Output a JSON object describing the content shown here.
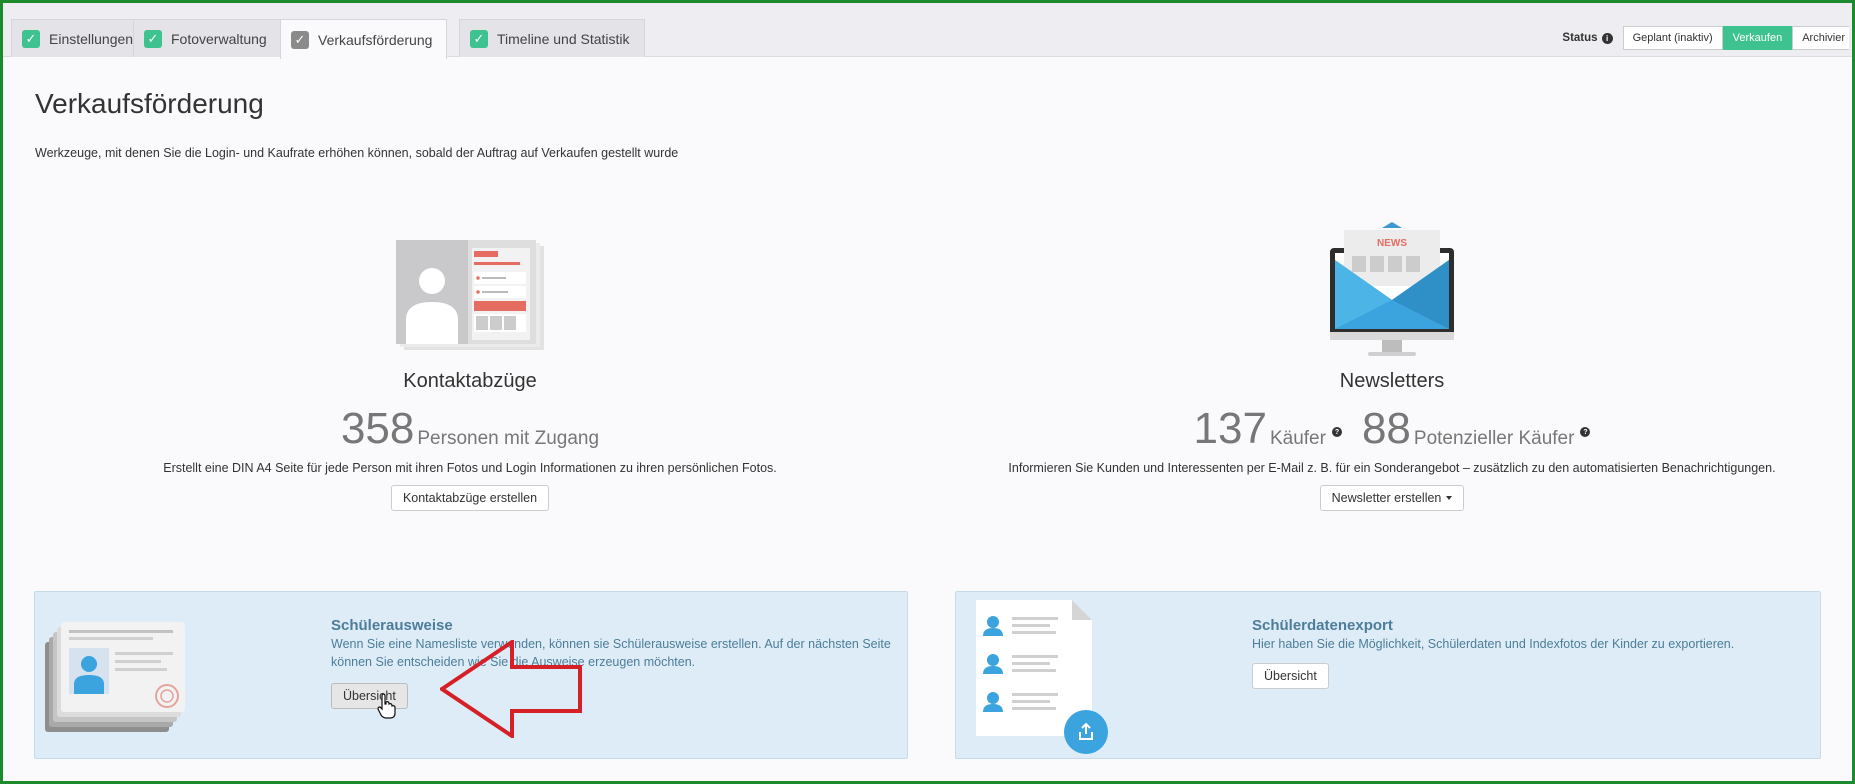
{
  "tabs": [
    {
      "label": "Einstellungen",
      "active": false
    },
    {
      "label": "Fotoverwaltung",
      "active": false
    },
    {
      "label": "Verkaufsförderung",
      "active": true
    },
    {
      "label": "Timeline und Statistik",
      "active": false
    }
  ],
  "status": {
    "label": "Status",
    "options": [
      "Geplant (inaktiv)",
      "Verkaufen",
      "Archivier"
    ],
    "selected": "Verkaufen"
  },
  "header": {
    "title": "Verkaufsförderung",
    "subtitle": "Werkzeuge, mit denen Sie die Login- und Kaufrate erhöhen können, sobald der Auftrag auf Verkaufen gestellt wurde"
  },
  "kontakt": {
    "title": "Kontaktabzüge",
    "count": "358",
    "count_label": "Personen mit Zugang",
    "description": "Erstellt eine DIN A4 Seite für jede Person mit ihren Fotos und Login Informationen zu ihren persönlichen Fotos.",
    "button": "Kontaktabzüge erstellen"
  },
  "newsletter": {
    "title": "Newsletters",
    "buyers": "137",
    "buyers_label": "Käufer",
    "potential": "88",
    "potential_label": "Potenzieller Käufer",
    "description": "Informieren Sie Kunden und Interessenten per E-Mail z. B. für ein Sonderangebot – zusätzlich zu den automatisierten Benachrichtigungen.",
    "button": "Newsletter erstellen",
    "badge": "NEWS"
  },
  "ausweise": {
    "title": "Schülerausweise",
    "text": "Wenn Sie eine Namesliste verwenden, können sie Schülerausweise erstellen. Auf der nächsten Seite können Sie entscheiden wie Sie die Ausweise erzeugen möchten.",
    "button": "Übersicht"
  },
  "export": {
    "title": "Schülerdatenexport",
    "text": "Hier haben Sie die Möglichkeit, Schülerdaten und Indexfotos der Kinder zu exportieren.",
    "button": "Übersicht"
  },
  "colors": {
    "accent_green": "#3ec28f",
    "panel_blue": "#ddecf6",
    "panel_text": "#4d7d9a",
    "annotation_red": "#d62027",
    "frame_green": "#1e8a2e"
  },
  "icons": [
    "check-icon",
    "info-icon",
    "question-icon",
    "share-icon",
    "hand-cursor-icon",
    "arrow-annotation"
  ]
}
